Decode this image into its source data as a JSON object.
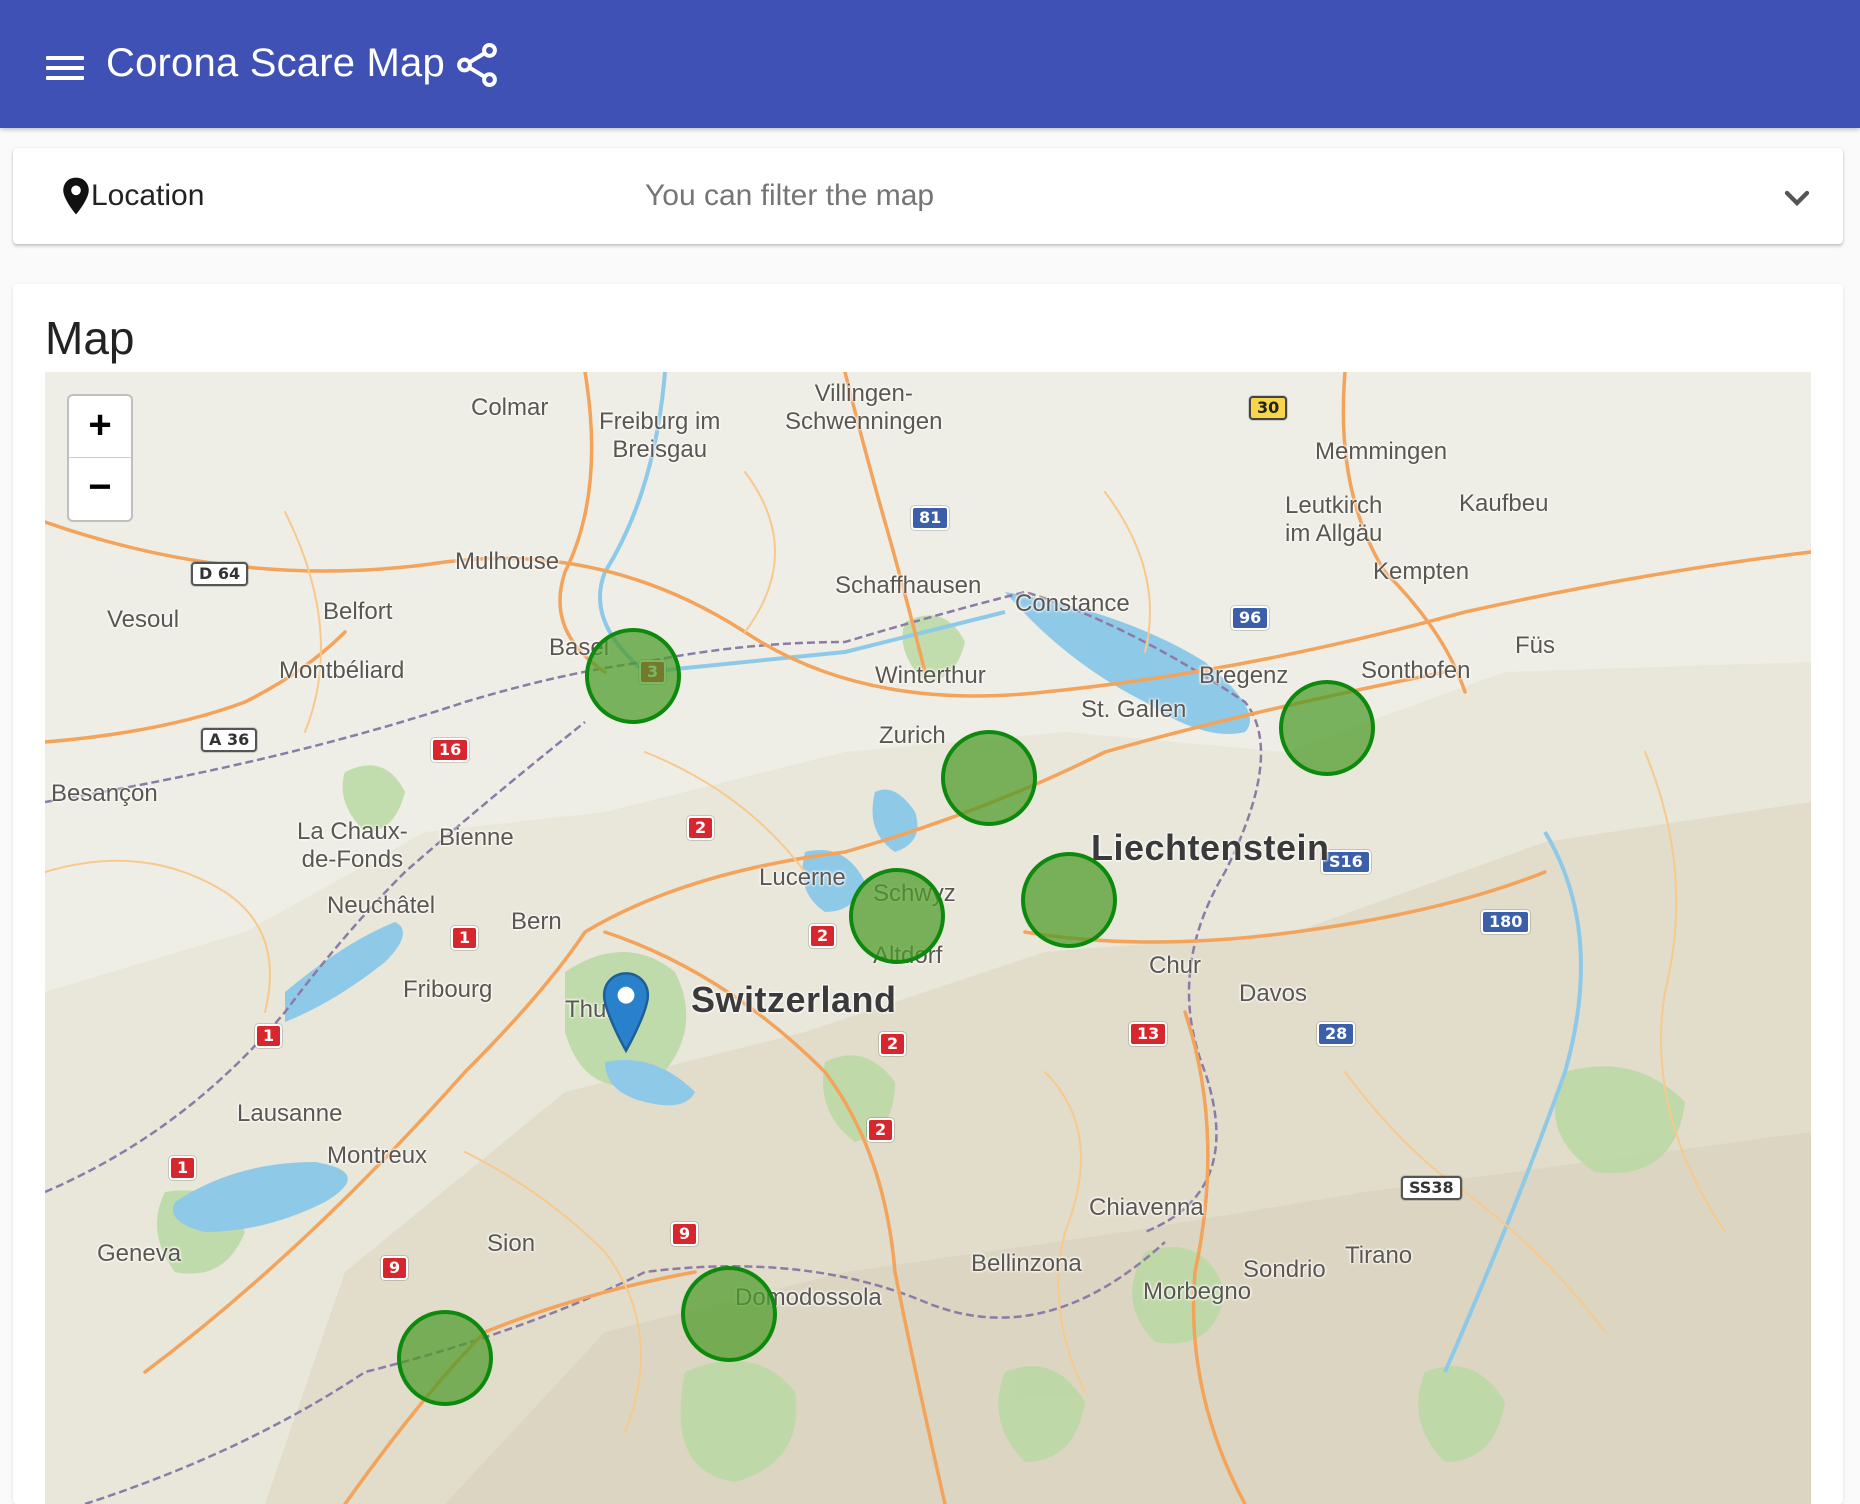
{
  "app": {
    "title": "Corona Scare Map"
  },
  "icons": {
    "menu": "menu-icon",
    "share": "share-icon",
    "location": "map-pin-icon",
    "expand": "chevron-down-icon"
  },
  "filter": {
    "label": "Location",
    "placeholder": "You can filter the map"
  },
  "map_section": {
    "title": "Map"
  },
  "map": {
    "zoom_in": "+",
    "zoom_out": "−",
    "places": [
      {
        "id": "colmar",
        "label": "Colmar"
      },
      {
        "id": "freiburg",
        "label": "Freiburg im\nBreisgau"
      },
      {
        "id": "villingen",
        "label": "Villingen-\nSchwenningen"
      },
      {
        "id": "memmingen",
        "label": "Memmingen"
      },
      {
        "id": "kaufbeuren",
        "label": "Kaufbeu"
      },
      {
        "id": "leutkirch",
        "label": "Leutkirch\nim Allgäu"
      },
      {
        "id": "kempten",
        "label": "Kempten"
      },
      {
        "id": "mulhouse",
        "label": "Mulhouse"
      },
      {
        "id": "schaffhausen",
        "label": "Schaffhausen"
      },
      {
        "id": "constance",
        "label": "Constance"
      },
      {
        "id": "vesoul",
        "label": "Vesoul"
      },
      {
        "id": "belfort",
        "label": "Belfort"
      },
      {
        "id": "basel",
        "label": "Basel"
      },
      {
        "id": "montbeliard",
        "label": "Montbéliard"
      },
      {
        "id": "winterthur",
        "label": "Winterthur"
      },
      {
        "id": "bregenz",
        "label": "Bregenz"
      },
      {
        "id": "sonthofen",
        "label": "Sonthofen"
      },
      {
        "id": "fussen",
        "label": "Füs"
      },
      {
        "id": "stgallen",
        "label": "St. Gallen"
      },
      {
        "id": "zurich",
        "label": "Zurich"
      },
      {
        "id": "besancon",
        "label": "Besançon"
      },
      {
        "id": "lachaux",
        "label": "La Chaux-\nde-Fonds"
      },
      {
        "id": "bienne",
        "label": "Bienne"
      },
      {
        "id": "liechtenstein",
        "label": "Liechtenstein"
      },
      {
        "id": "lucerne",
        "label": "Lucerne"
      },
      {
        "id": "schwyz",
        "label": "Schwyz"
      },
      {
        "id": "neuchatel",
        "label": "Neuchâtel"
      },
      {
        "id": "bern",
        "label": "Bern"
      },
      {
        "id": "altdorf",
        "label": "Altdorf"
      },
      {
        "id": "chur",
        "label": "Chur"
      },
      {
        "id": "fribourg",
        "label": "Fribourg"
      },
      {
        "id": "thun",
        "label": "Thun"
      },
      {
        "id": "switzerland",
        "label": "Switzerland"
      },
      {
        "id": "davos",
        "label": "Davos"
      },
      {
        "id": "lausanne",
        "label": "Lausanne"
      },
      {
        "id": "montreux",
        "label": "Montreux"
      },
      {
        "id": "chiavenna",
        "label": "Chiavenna"
      },
      {
        "id": "geneva",
        "label": "Geneva"
      },
      {
        "id": "sion",
        "label": "Sion"
      },
      {
        "id": "bellinzona",
        "label": "Bellinzona"
      },
      {
        "id": "tirano",
        "label": "Tirano"
      },
      {
        "id": "sondrio",
        "label": "Sondrio"
      },
      {
        "id": "morbegno",
        "label": "Morbegno"
      },
      {
        "id": "domodossola",
        "label": "Domodossola"
      }
    ],
    "road_shields": [
      {
        "id": "r30",
        "label": "30",
        "kind": "de"
      },
      {
        "id": "r81",
        "label": "81",
        "kind": "blue"
      },
      {
        "id": "rd64",
        "label": "D 64",
        "kind": "fr"
      },
      {
        "id": "r96",
        "label": "96",
        "kind": "blue"
      },
      {
        "id": "r3",
        "label": "3",
        "kind": "red"
      },
      {
        "id": "r16",
        "label": "16",
        "kind": "red"
      },
      {
        "id": "ra36",
        "label": "A 36",
        "kind": "fr"
      },
      {
        "id": "r2a",
        "label": "2",
        "kind": "red"
      },
      {
        "id": "rs16",
        "label": "S16",
        "kind": "blue"
      },
      {
        "id": "r180",
        "label": "180",
        "kind": "blue"
      },
      {
        "id": "r1a",
        "label": "1",
        "kind": "red"
      },
      {
        "id": "r2b",
        "label": "2",
        "kind": "red"
      },
      {
        "id": "r1b",
        "label": "1",
        "kind": "red"
      },
      {
        "id": "r2c",
        "label": "2",
        "kind": "red"
      },
      {
        "id": "r13",
        "label": "13",
        "kind": "red"
      },
      {
        "id": "r28",
        "label": "28",
        "kind": "blue"
      },
      {
        "id": "r2d",
        "label": "2",
        "kind": "red"
      },
      {
        "id": "r1c",
        "label": "1",
        "kind": "red"
      },
      {
        "id": "rss38",
        "label": "SS38",
        "kind": "it"
      },
      {
        "id": "r9a",
        "label": "9",
        "kind": "red"
      },
      {
        "id": "r9b",
        "label": "9",
        "kind": "red"
      }
    ],
    "hotspots": [
      "basel",
      "zurich",
      "st-gallen",
      "zug",
      "lucerne",
      "valais-east",
      "valais-west"
    ]
  }
}
